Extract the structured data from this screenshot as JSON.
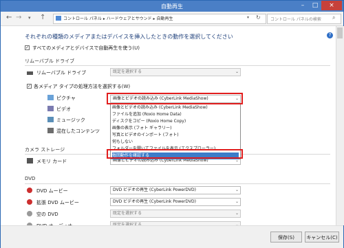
{
  "title": "自動再生",
  "nav": {
    "breadcrumb": "コントロール パネル ▸ ハードウェアとサウンド ▸ 自動再生",
    "search_placeholder": "コントロール パネルの検索"
  },
  "heading": "それぞれの種類のメディアまたはデバイスを挿入したときの動作を選択してください",
  "use_autoplay_label": "すべてのメディアとデバイスで自動再生を使う(U)",
  "removable": {
    "section": "リムーバブル ドライブ",
    "drive_label": "リムーバブル ドライブ",
    "drive_value": "既定を選択する",
    "per_media_label": "各メディア タイプの処理方法を選択する(W)",
    "items": [
      {
        "label": "ピクチャ",
        "value": "画像とビデオの読み込み (CyberLink MediaShow)"
      },
      {
        "label": "ビデオ",
        "value": ""
      },
      {
        "label": "ミュージック",
        "value": ""
      },
      {
        "label": "混在したコンテンツ",
        "value": ""
      }
    ]
  },
  "dropdown_options": [
    "画像とビデオの読み込み (CyberLink MediaShow)",
    "ファイルを追加 (Roxio Home Data)",
    "ディスクをコピー (Roxio Home Copy)",
    "画像の表示 (フォト ギャラリー)",
    "写真とビデオのインポート (フォト)",
    "何もしない",
    "フォルダーを開いてファイルを表示 (エクスプローラー)",
    "毎回動作を確認する"
  ],
  "camera": {
    "section": "カメラ ストレージ",
    "card_label": "メモリ カード",
    "card_value": "画像とビデオの読み込み (CyberLink MediaShow)"
  },
  "dvd": {
    "section": "DVD",
    "items": [
      {
        "label": "DVD ムービー",
        "value": "DVD ビデオの再生 (CyberLink PowerDVD)"
      },
      {
        "label": "拡張 DVD ムービー",
        "value": "DVD ビデオの再生 (CyberLink PowerDVD)"
      },
      {
        "label": "空の DVD",
        "value": "既定を選択する"
      },
      {
        "label": "DVD オーディオ",
        "value": "既定を選択する"
      }
    ]
  },
  "buttons": {
    "save": "保存(S)",
    "cancel": "キャンセル(C)"
  },
  "colors": {
    "accent": "#4a7fc6",
    "highlight_border": "#e11d1d",
    "selected_option": "#3d7cc9"
  }
}
